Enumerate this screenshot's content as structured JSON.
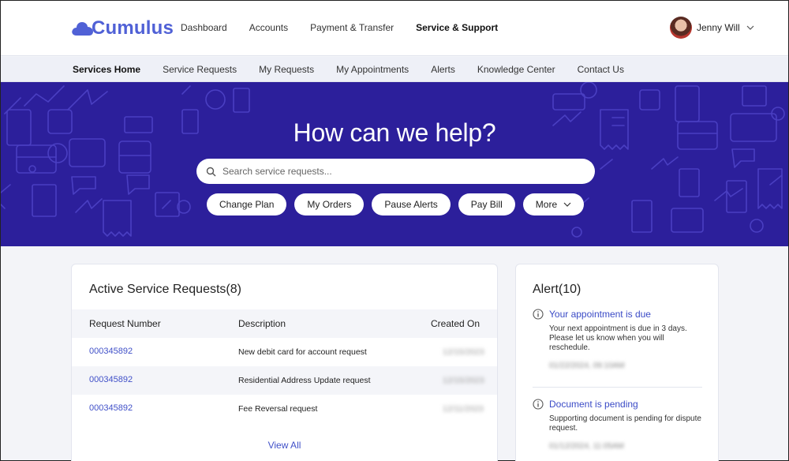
{
  "header": {
    "logo": "Cumulus",
    "nav": [
      "Dashboard",
      "Accounts",
      "Payment & Transfer",
      "Service & Support"
    ],
    "active_nav": "Service & Support",
    "user_name": "Jenny Will"
  },
  "subnav": {
    "items": [
      "Services Home",
      "Service Requests",
      "My Requests",
      "My Appointments",
      "Alerts",
      "Knowledge Center",
      "Contact Us"
    ],
    "active": "Services Home"
  },
  "hero": {
    "title": "How can we help?",
    "search_placeholder": "Search service requests...",
    "actions": [
      "Change Plan",
      "My Orders",
      "Pause Alerts",
      "Pay Bill",
      "More"
    ]
  },
  "requests": {
    "title": "Active Service Requests(8)",
    "columns": [
      "Request Number",
      "Description",
      "Created On"
    ],
    "rows": [
      {
        "number": "000345892",
        "description": "New debit card for account request",
        "created": "12/15/2023"
      },
      {
        "number": "000345892",
        "description": "Residential Address Update request",
        "created": "12/15/2023"
      },
      {
        "number": "000345892",
        "description": "Fee Reversal request",
        "created": "12/11/2023"
      }
    ],
    "view_all": "View All"
  },
  "alerts": {
    "title": "Alert(10)",
    "items": [
      {
        "title": "Your appointment is due",
        "body": "Your next appointment is due in 3 days. Please let us know when you will reschedule.",
        "meta": "01/22/2024, 09:10AM"
      },
      {
        "title": "Document is pending",
        "body": "Supporting document is pending for dispute request.",
        "meta": "01/12/2024, 11:05AM"
      }
    ]
  },
  "colors": {
    "brand": "#5061d6",
    "hero_bg": "#2c1f9b",
    "link": "#4050c8"
  }
}
